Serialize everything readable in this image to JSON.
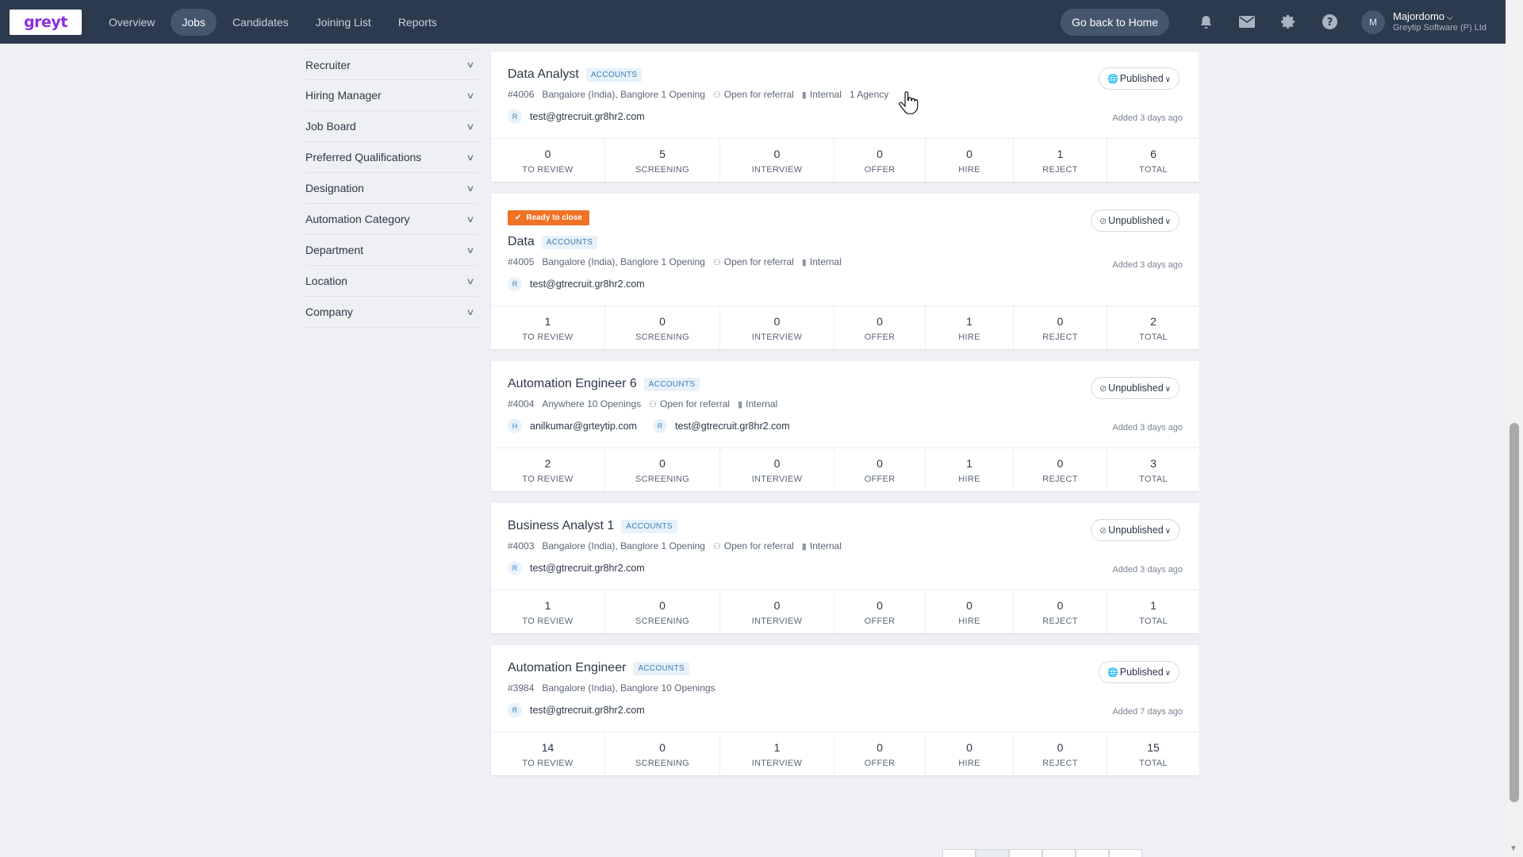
{
  "brand": {
    "logo_text": "greyt"
  },
  "nav": {
    "items": [
      "Overview",
      "Jobs",
      "Candidates",
      "Joining List",
      "Reports"
    ],
    "active": "Jobs"
  },
  "header": {
    "home_button": "Go back to Home",
    "icons": [
      "bell-icon",
      "mail-icon",
      "gear-icon",
      "help-icon"
    ],
    "user": {
      "initial": "M",
      "name": "Majordomo",
      "org": "Greytip Software (P) Ltd"
    }
  },
  "filters": [
    "Recruiter",
    "Hiring Manager",
    "Job Board",
    "Preferred Qualifications",
    "Designation",
    "Automation Category",
    "Department",
    "Location",
    "Company"
  ],
  "stat_labels": [
    "TO REVIEW",
    "SCREENING",
    "INTERVIEW",
    "OFFER",
    "HIRE",
    "REJECT",
    "TOTAL"
  ],
  "jobs": [
    {
      "title": "Data Analyst",
      "dept": "ACCOUNTS",
      "ready_to_close": "",
      "id": "#4006",
      "location": "Bangalore (India), Banglore",
      "openings": "1 Opening",
      "referral": "Open for referral",
      "type": "Internal",
      "agency": "1  Agency",
      "recruiters": [
        {
          "initial": "R",
          "email": "test@gtrecruit.gr8hr2.com"
        }
      ],
      "status": "Published",
      "added": "Added 3 days ago",
      "stats": [
        "0",
        "5",
        "0",
        "0",
        "0",
        "1",
        "6"
      ]
    },
    {
      "title": "Data",
      "dept": "ACCOUNTS",
      "ready_to_close": "Ready to close",
      "id": "#4005",
      "location": "Bangalore (India), Banglore",
      "openings": "1 Opening",
      "referral": "Open for referral",
      "type": "Internal",
      "agency": "",
      "recruiters": [
        {
          "initial": "R",
          "email": "test@gtrecruit.gr8hr2.com"
        }
      ],
      "status": "Unpublished",
      "added": "Added 3 days ago",
      "stats": [
        "1",
        "0",
        "0",
        "0",
        "1",
        "0",
        "2"
      ]
    },
    {
      "title": "Automation Engineer 6",
      "dept": "ACCOUNTS",
      "ready_to_close": "",
      "id": "#4004",
      "location": "Anywhere",
      "openings": "10 Openings",
      "referral": "Open for referral",
      "type": "Internal",
      "agency": "",
      "recruiters": [
        {
          "initial": "H",
          "email": "anilkumar@grteytip.com"
        },
        {
          "initial": "R",
          "email": "test@gtrecruit.gr8hr2.com"
        }
      ],
      "status": "Unpublished",
      "added": "Added 3 days ago",
      "stats": [
        "2",
        "0",
        "0",
        "0",
        "1",
        "0",
        "3"
      ]
    },
    {
      "title": "Business Analyst 1",
      "dept": "ACCOUNTS",
      "ready_to_close": "",
      "id": "#4003",
      "location": "Bangalore (India), Banglore",
      "openings": "1 Opening",
      "referral": "Open for referral",
      "type": "Internal",
      "agency": "",
      "recruiters": [
        {
          "initial": "R",
          "email": "test@gtrecruit.gr8hr2.com"
        }
      ],
      "status": "Unpublished",
      "added": "Added 3 days ago",
      "stats": [
        "1",
        "0",
        "0",
        "0",
        "0",
        "0",
        "1"
      ]
    },
    {
      "title": "Automation Engineer",
      "dept": "ACCOUNTS",
      "ready_to_close": "",
      "id": "#3984",
      "location": "Bangalore (India), Banglore",
      "openings": "10 Openings",
      "referral": "",
      "type": "",
      "agency": "",
      "recruiters": [
        {
          "initial": "R",
          "email": "test@gtrecruit.gr8hr2.com"
        }
      ],
      "status": "Published",
      "added": "Added 7 days ago",
      "stats": [
        "14",
        "0",
        "1",
        "0",
        "0",
        "0",
        "15"
      ]
    }
  ]
}
